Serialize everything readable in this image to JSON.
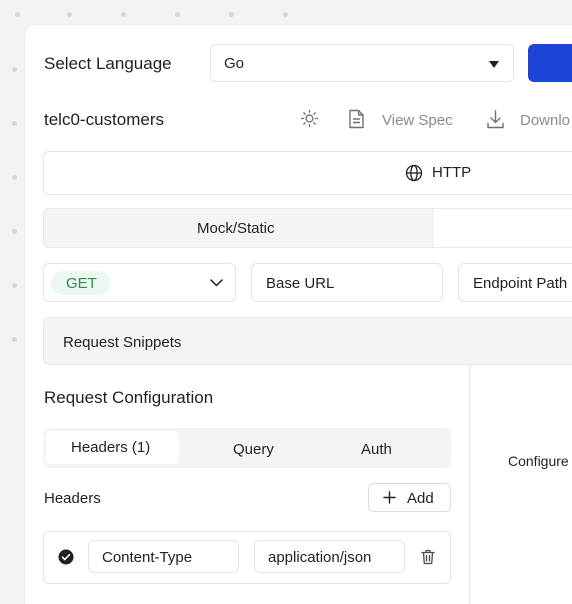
{
  "language": {
    "label": "Select Language",
    "selected": "Go"
  },
  "project": {
    "name": "telc0-customers",
    "view_spec": "View Spec",
    "download": "Downlo"
  },
  "protocol": {
    "label": "HTTP"
  },
  "mode_tabs": {
    "active": "Mock/Static"
  },
  "request": {
    "method": "GET",
    "base_url": "Base URL",
    "endpoint_path": "Endpoint Path",
    "snippets": "Request Snippets"
  },
  "config": {
    "title": "Request Configuration",
    "tabs": [
      "Headers (1)",
      "Query",
      "Auth"
    ],
    "headers_label": "Headers",
    "add_label": "Add",
    "header_row": {
      "key": "Content-Type",
      "value": "application/json"
    },
    "right_hint": "Configure"
  },
  "colors": {
    "accent": "#1e44d8",
    "method_green": "#2e8a4f",
    "method_bg": "#ecf7ef"
  }
}
